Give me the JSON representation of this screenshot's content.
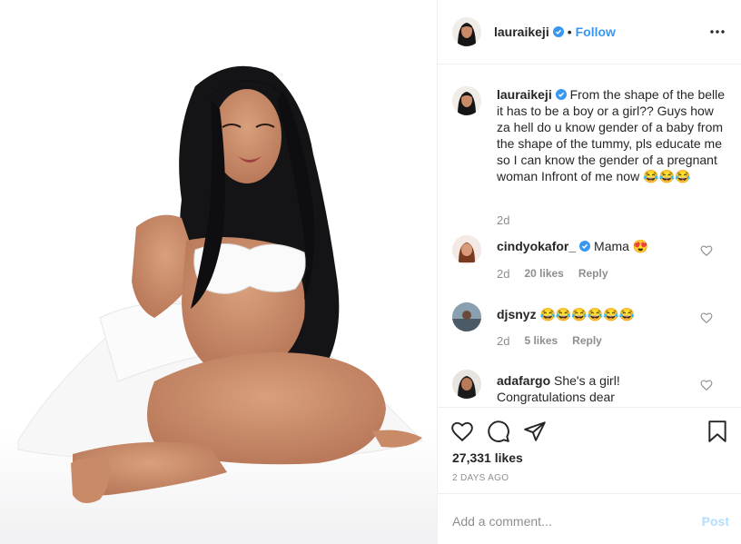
{
  "post": {
    "author": "lauraikeji",
    "follow_label": "Follow",
    "separator": "•",
    "caption_author": "lauraikeji",
    "caption": "From the shape of the belle it has to be a boy or a girl?? Guys how za hell do u know gender of a baby from the shape of the tummy, pls educate me so I can know the gender of a pregnant woman Infront of me now 😂😂😂",
    "caption_time": "2d",
    "likes": "27,331 likes",
    "posted_ago": "2 DAYS AGO"
  },
  "comments": [
    {
      "user": "cindyokafor_",
      "verified": true,
      "text": "Mama 😍",
      "time": "2d",
      "likes": "20 likes",
      "reply": "Reply"
    },
    {
      "user": "djsnyz",
      "verified": false,
      "text": "😂😂😂😂😂😂",
      "time": "2d",
      "likes": "5 likes",
      "reply": "Reply"
    },
    {
      "user": "adafargo",
      "verified": false,
      "text": "She's a girl! Congratulations dear"
    }
  ],
  "add_comment": {
    "placeholder": "Add a comment...",
    "post_label": "Post"
  },
  "colors": {
    "link_blue": "#3897f0",
    "verified_blue": "#3897f0",
    "muted": "#8e8e8e",
    "post_disabled": "#b2dffc"
  },
  "icons": [
    "verified-badge-icon",
    "more-options-icon",
    "heart-icon",
    "comment-icon",
    "share-icon",
    "bookmark-icon"
  ]
}
